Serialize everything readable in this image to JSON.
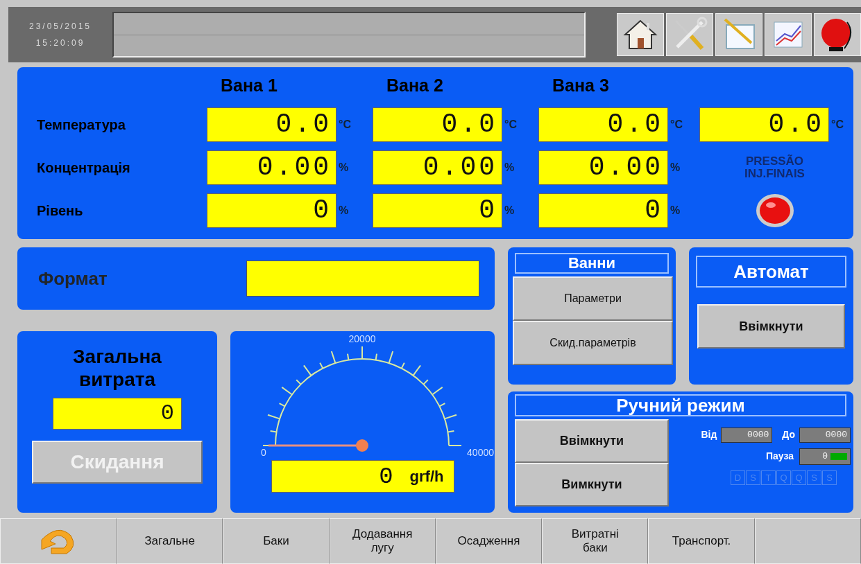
{
  "header": {
    "date": "23/05/2015",
    "time": "15:20:09"
  },
  "baths": {
    "columns": [
      "Вана 1",
      "Вана 2",
      "Вана 3"
    ],
    "rows": [
      {
        "label": "Температура",
        "cells": [
          {
            "value": "0.0",
            "unit": "°C"
          },
          {
            "value": "0.0",
            "unit": "°C"
          },
          {
            "value": "0.0",
            "unit": "°C"
          }
        ],
        "extra": {
          "value": "0.0",
          "unit": "°C"
        }
      },
      {
        "label": "Концентрація",
        "cells": [
          {
            "value": "0.00",
            "unit": "%"
          },
          {
            "value": "0.00",
            "unit": "%"
          },
          {
            "value": "0.00",
            "unit": "%"
          }
        ]
      },
      {
        "label": "Рівень",
        "cells": [
          {
            "value": "0",
            "unit": "%"
          },
          {
            "value": "0",
            "unit": "%"
          },
          {
            "value": "0",
            "unit": "%"
          }
        ]
      }
    ],
    "indicator": {
      "label": "PRESSÃO\nINJ.FINAIS",
      "on": true
    }
  },
  "format": {
    "label": "Формат"
  },
  "vanny": {
    "title": "Ванни",
    "buttons": [
      "Параметри",
      "Скид.параметрів"
    ]
  },
  "auto": {
    "title": "Автомат",
    "button": "Ввімкнути"
  },
  "total": {
    "title": "Загальна витрата",
    "value": "0",
    "button": {
      "label": "Скидання",
      "disabled": true
    }
  },
  "gauge": {
    "min": "0",
    "mid": "20000",
    "max": "40000",
    "reading": "0",
    "unit": "grf/h"
  },
  "manual": {
    "title": "Ручний режим",
    "buttons": [
      "Ввімкнути",
      "Вимкнути"
    ],
    "from": {
      "label": "Від",
      "value": "0000"
    },
    "to": {
      "label": "До",
      "value": "0000"
    },
    "pause": {
      "label": "Пауза",
      "value": "0"
    },
    "days": [
      {
        "label": "D",
        "active": false
      },
      {
        "label": "S",
        "active": false
      },
      {
        "label": "T",
        "active": false
      },
      {
        "label": "Q",
        "active": false
      },
      {
        "label": "Q",
        "active": false
      },
      {
        "label": "S",
        "active": false
      },
      {
        "label": "S",
        "active": false
      }
    ]
  },
  "tabs": [
    {
      "kind": "back"
    },
    {
      "kind": "text",
      "label": "Загальне"
    },
    {
      "kind": "text",
      "label": "Баки"
    },
    {
      "kind": "text",
      "label": "Додавання\nлугу"
    },
    {
      "kind": "text",
      "label": "Осадження"
    },
    {
      "kind": "text",
      "label": "Витратні\nбаки"
    },
    {
      "kind": "text",
      "label": "Транспорт."
    },
    {
      "kind": "empty"
    }
  ]
}
